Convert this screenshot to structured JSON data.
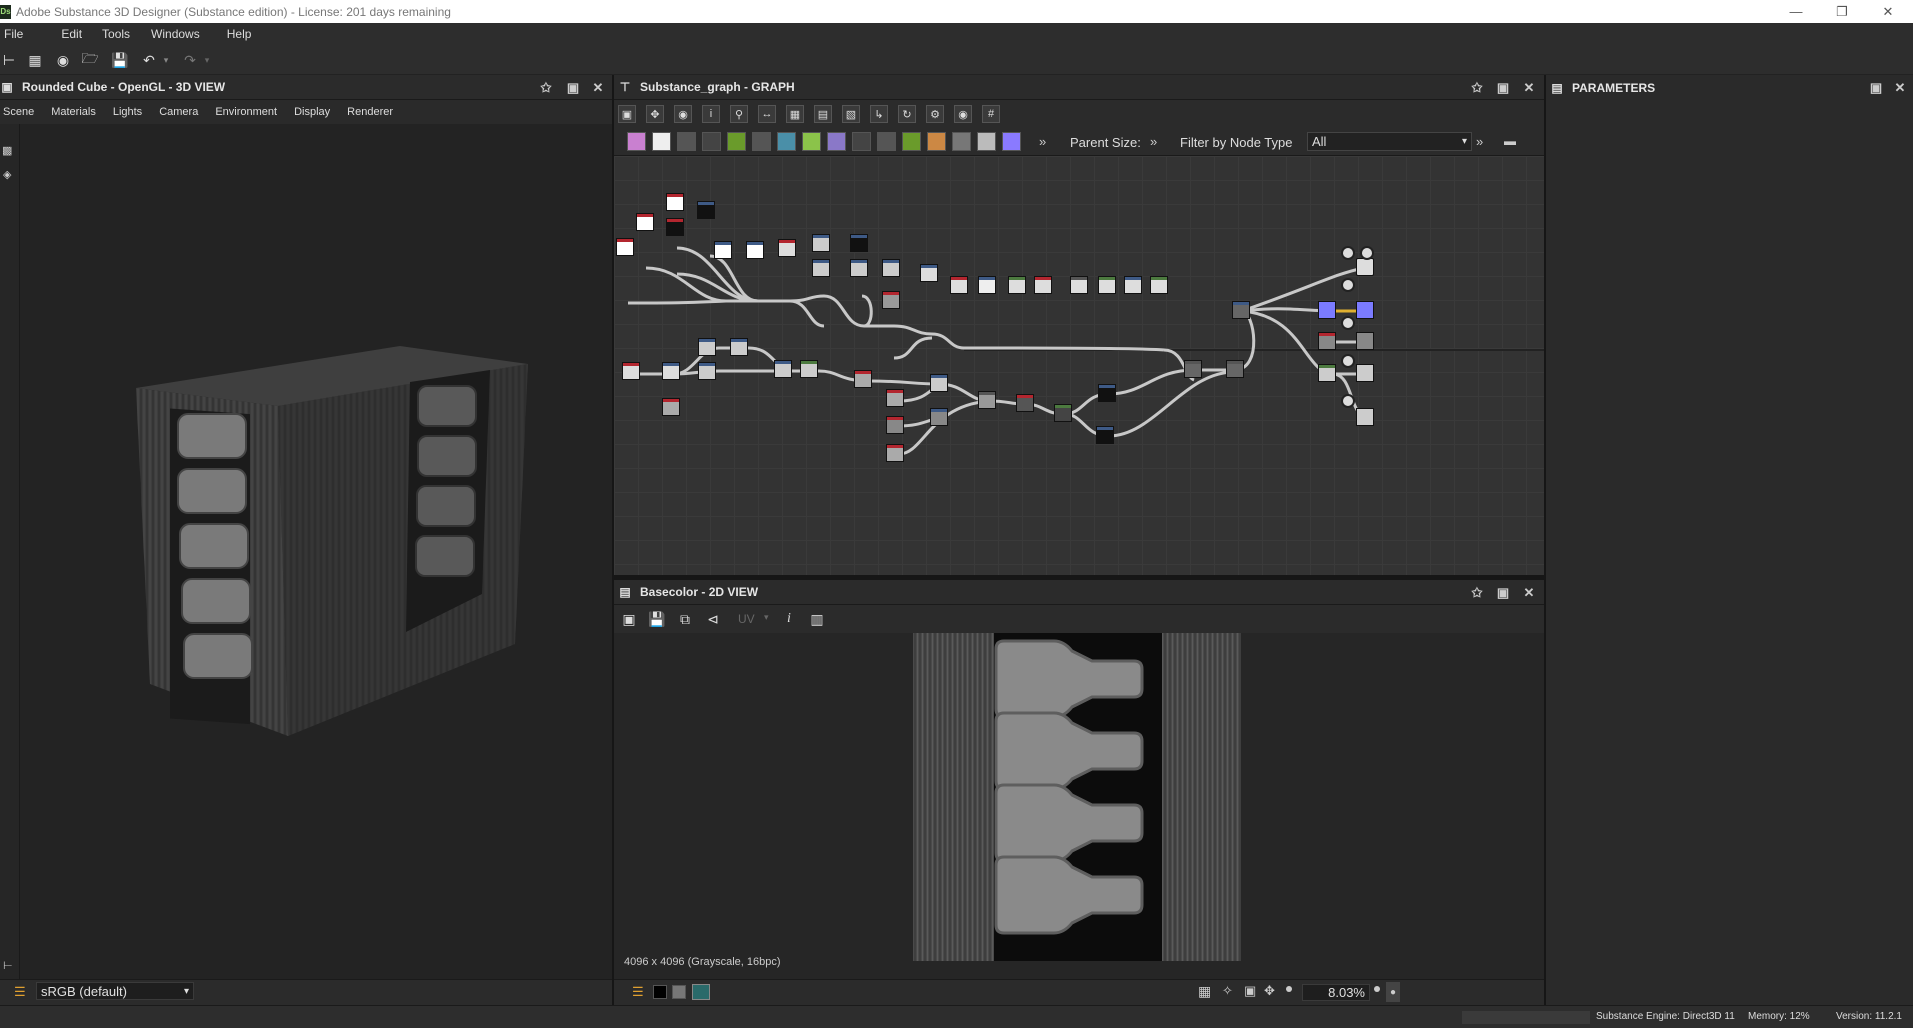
{
  "window": {
    "title": "Adobe Substance 3D Designer (Substance edition) - License: 201 days remaining",
    "app_badge": "Ds"
  },
  "menu": [
    "File",
    "Edit",
    "Tools",
    "Windows",
    "Help"
  ],
  "view3d": {
    "title": "Rounded Cube - OpenGL - 3D VIEW",
    "menu": [
      "Scene",
      "Materials",
      "Lights",
      "Camera",
      "Environment",
      "Display",
      "Renderer"
    ],
    "colorspace": "sRGB (default)"
  },
  "graph": {
    "title": "Substance_graph - GRAPH",
    "parent_size_label": "Parent Size:",
    "filter_label": "Filter by Node Type",
    "filter_value": "All"
  },
  "view2d": {
    "title": "Basecolor - 2D VIEW",
    "uv_label": "UV",
    "image_info": "4096 x 4096 (Grayscale, 16bpc)",
    "zoom": "8.03%"
  },
  "parameters": {
    "title": "PARAMETERS"
  },
  "status": {
    "engine": "Substance Engine: Direct3D 11",
    "memory": "Memory: 12%",
    "version": "Version: 11.2.1"
  },
  "colors": {
    "node_red": "#b3262f",
    "node_blue": "#3e5a86",
    "node_green": "#4c7a3f",
    "output_purple": "#7b7bff"
  }
}
